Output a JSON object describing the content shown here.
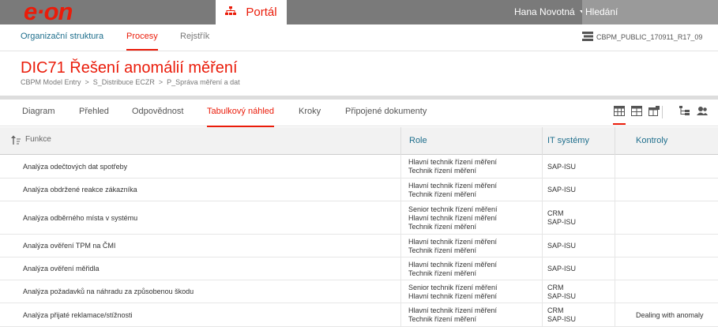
{
  "topbar": {
    "logo": "e·on",
    "portal_label": "Portál",
    "user_name": "Hana Novotná",
    "search_placeholder": "Hledání"
  },
  "subnav": {
    "items": [
      "Organizační struktura",
      "Procesy",
      "Rejstřík"
    ],
    "active": "Procesy",
    "model_label": "CBPM_PUBLIC_170911_R17_09"
  },
  "page": {
    "title": "DIC71 Řešení anomálií měření",
    "breadcrumb": [
      "CBPM Model Entry",
      "S_Distribuce ECZR",
      "P_Správa měření a dat"
    ]
  },
  "tabs": {
    "items": [
      "Diagram",
      "Přehled",
      "Odpovědnost",
      "Tabulkový náhled",
      "Kroky",
      "Připojené dokumenty"
    ],
    "active": "Tabulkový náhled"
  },
  "table": {
    "headers": {
      "function": "Funkce",
      "role": "Role",
      "it": "IT systémy",
      "controls": "Kontroly"
    },
    "rows": [
      {
        "function": "Analýza odečtových dat spotřeby",
        "roles": [
          "Hlavní technik řízení měření",
          "Technik řízení měření"
        ],
        "it": [
          "SAP-ISU"
        ],
        "controls": ""
      },
      {
        "function": "Analýza obdržené reakce zákazníka",
        "roles": [
          "Hlavní technik řízení měření",
          "Technik řízení měření"
        ],
        "it": [
          "SAP-ISU"
        ],
        "controls": ""
      },
      {
        "function": "Analýza odběrného místa v systému",
        "roles": [
          "Senior technik řízení měření",
          "Hlavní technik řízení měření",
          "Technik řízení měření"
        ],
        "it": [
          "CRM",
          "SAP-ISU"
        ],
        "controls": ""
      },
      {
        "function": "Analýza ověření TPM na ČMI",
        "roles": [
          "Hlavní technik řízení měření",
          "Technik řízení měření"
        ],
        "it": [
          "SAP-ISU"
        ],
        "controls": ""
      },
      {
        "function": "Analýza ověření měřidla",
        "roles": [
          "Hlavní technik řízení měření",
          "Technik řízení měření"
        ],
        "it": [
          "SAP-ISU"
        ],
        "controls": ""
      },
      {
        "function": "Analýza požadavků na náhradu za způsobenou škodu",
        "roles": [
          "Senior technik řízení měření",
          "Hlavní technik řízení měření"
        ],
        "it": [
          "CRM",
          "SAP-ISU"
        ],
        "controls": ""
      },
      {
        "function": "Analýza přijaté reklamace/stížnosti",
        "roles": [
          "Hlavní technik řízení měření",
          "Technik řízení měření"
        ],
        "it": [
          "CRM",
          "SAP-ISU"
        ],
        "controls": "Dealing with anomaly"
      }
    ]
  },
  "colors": {
    "brand": "#ea1c0a",
    "topbar": "#7a7a7a",
    "link": "#1e6e8c"
  }
}
